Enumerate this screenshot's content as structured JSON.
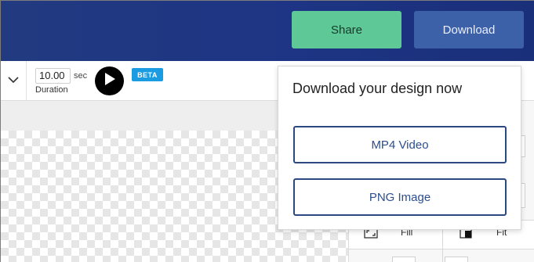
{
  "header": {
    "share_label": "Share",
    "download_label": "Download"
  },
  "toolbar": {
    "duration_value": "10.00",
    "duration_unit": "sec",
    "duration_label": "Duration",
    "beta_badge": "BETA",
    "icons": {
      "collapse": "chevron-down-icon",
      "play": "play-icon"
    }
  },
  "right_panel": {
    "fill_label": "Fill",
    "fit_label": "Fit",
    "icons": {
      "fill": "expand-icon",
      "fit": "half-square-icon"
    }
  },
  "download_popup": {
    "title": "Download your design now",
    "options": [
      {
        "label": "MP4 Video"
      },
      {
        "label": "PNG Image"
      }
    ]
  },
  "colors": {
    "header_bg": "#1d3584",
    "share_bg": "#5ec996",
    "download_bg": "#3d61a8",
    "beta_bg": "#1b9be0",
    "option_border": "#2c4880"
  }
}
